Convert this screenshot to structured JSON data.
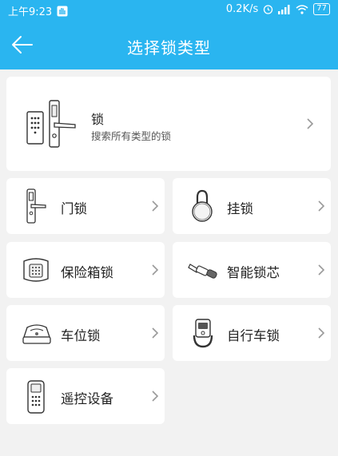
{
  "status_bar": {
    "time": "上午9:23",
    "network_speed": "0.2K/s",
    "battery": "77"
  },
  "header": {
    "title": "选择锁类型"
  },
  "all_locks": {
    "title": "锁",
    "subtitle": "搜索所有类型的锁"
  },
  "categories": [
    {
      "label": "门锁",
      "icon": "door-lock-icon"
    },
    {
      "label": "挂锁",
      "icon": "padlock-icon"
    },
    {
      "label": "保险箱锁",
      "icon": "safe-lock-icon"
    },
    {
      "label": "智能锁芯",
      "icon": "smart-cylinder-icon"
    },
    {
      "label": "车位锁",
      "icon": "parking-lock-icon"
    },
    {
      "label": "自行车锁",
      "icon": "bike-lock-icon"
    },
    {
      "label": "遥控设备",
      "icon": "remote-control-icon"
    }
  ],
  "colors": {
    "header": "#2ab5f0",
    "background": "#f2f2f2",
    "card": "#ffffff"
  }
}
